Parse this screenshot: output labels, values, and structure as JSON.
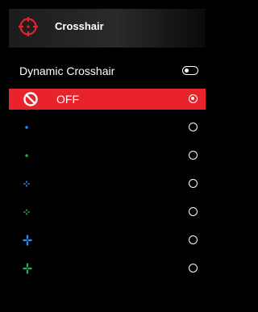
{
  "header": {
    "title": "Crosshair",
    "icon": "crosshair-icon",
    "accent_color": "#e8232b"
  },
  "dynamic_crosshair": {
    "label": "Dynamic Crosshair",
    "enabled": false
  },
  "options": [
    {
      "label": "OFF",
      "icon": "prohibited-icon",
      "color": "#ffffff",
      "selected": true
    },
    {
      "label": "",
      "icon": "small-dot-icon",
      "color": "#1e90ff",
      "selected": false
    },
    {
      "label": "",
      "icon": "small-dot-icon",
      "color": "#22b14c",
      "selected": false
    },
    {
      "label": "",
      "icon": "cross-small-icon",
      "color": "#1e90ff",
      "selected": false
    },
    {
      "label": "",
      "icon": "cross-small-icon",
      "color": "#22b14c",
      "selected": false
    },
    {
      "label": "",
      "icon": "cross-large-icon",
      "color": "#1e90ff",
      "selected": false
    },
    {
      "label": "",
      "icon": "cross-large-icon",
      "color": "#22b14c",
      "selected": false
    }
  ]
}
